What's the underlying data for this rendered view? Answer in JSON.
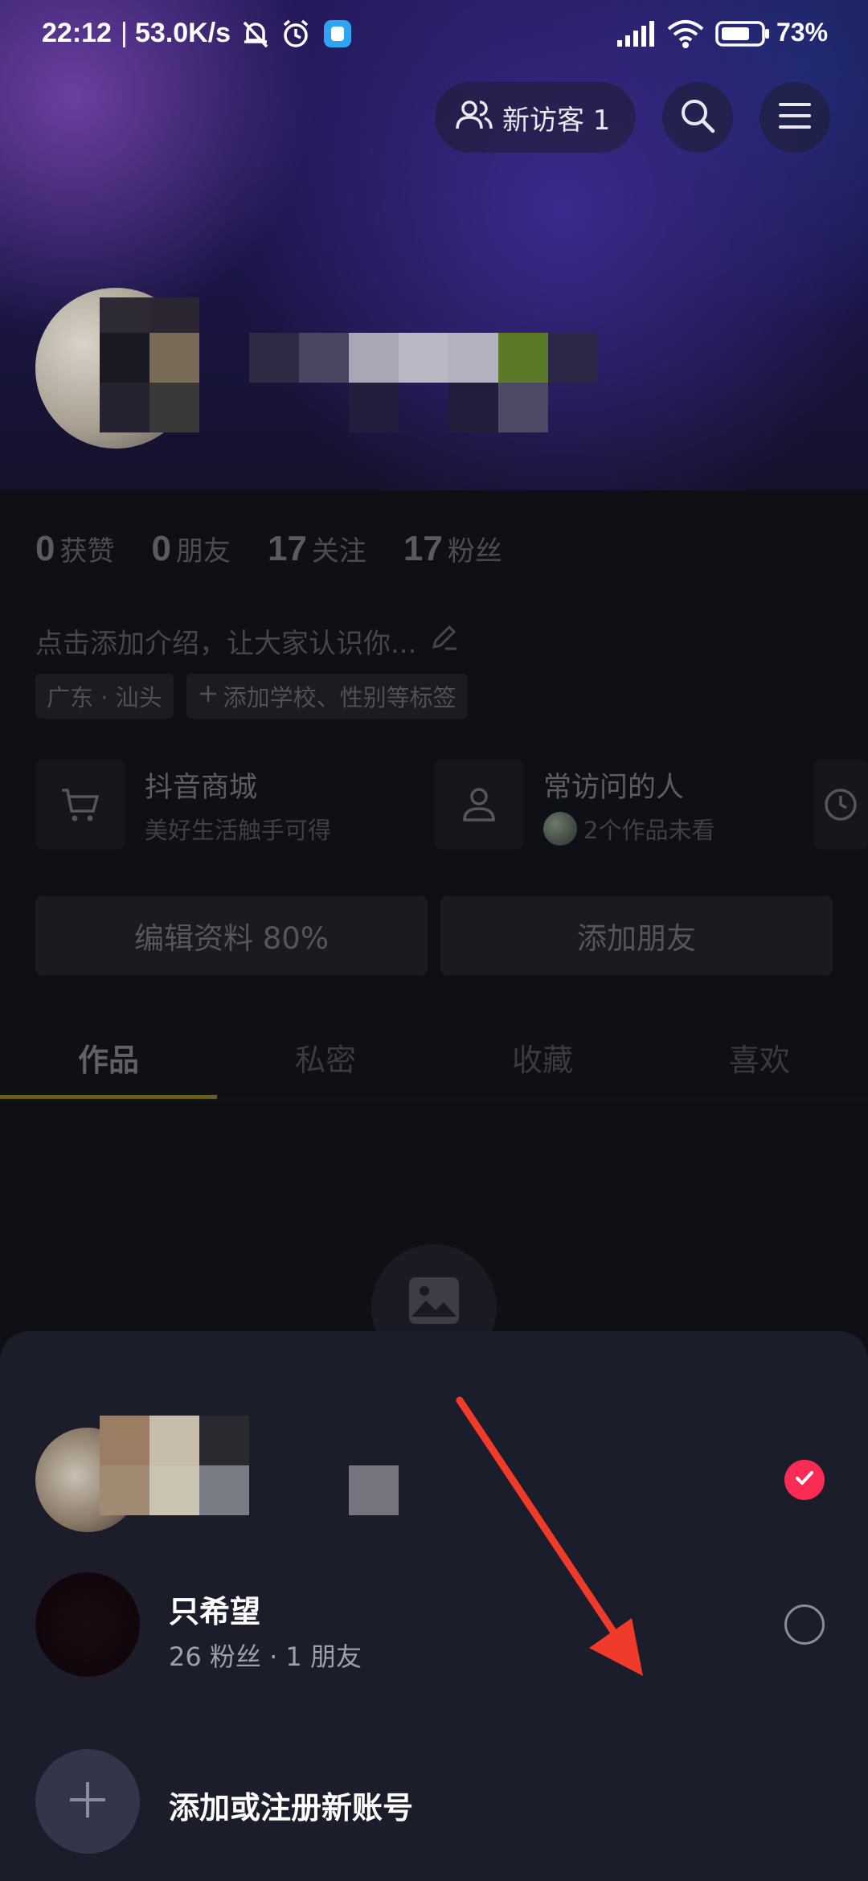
{
  "status_bar": {
    "time": "22:12",
    "separator": "|",
    "network_speed": "53.0K/s",
    "battery_percent": "73%",
    "icons": [
      "mute-bell-icon",
      "alarm-icon",
      "app-notification-icon",
      "signal-icon",
      "wifi-icon",
      "battery-icon"
    ]
  },
  "header": {
    "visitor_label": "新访客 1",
    "search_icon": "search-icon",
    "menu_icon": "menu-icon"
  },
  "profile": {
    "stats": [
      {
        "num": "0",
        "label": "获赞"
      },
      {
        "num": "0",
        "label": "朋友"
      },
      {
        "num": "17",
        "label": "关注"
      },
      {
        "num": "17",
        "label": "粉丝"
      }
    ],
    "bio_placeholder": "点击添加介绍，让大家认识你...",
    "tags": [
      "广东 · 汕头",
      "添加学校、性别等标签"
    ],
    "shortcuts": [
      {
        "title": "抖音商城",
        "subtitle": "美好生活触手可得"
      },
      {
        "title": "常访问的人",
        "subtitle": "2个作品未看"
      }
    ],
    "buttons": {
      "edit": "编辑资料 80%",
      "add_friend": "添加朋友"
    },
    "tabs": [
      "作品",
      "私密",
      "收藏",
      "喜欢"
    ]
  },
  "account_sheet": {
    "accounts": [
      {
        "name": "",
        "subtitle": "",
        "selected": true
      },
      {
        "name": "只希望",
        "subtitle": "26 粉丝  ·  1 朋友",
        "selected": false
      }
    ],
    "add_label": "添加或注册新账号"
  },
  "colors": {
    "accent_red": "#fe2c55",
    "annotation_arrow": "#f03a2a",
    "sheet_bg": "#1c1d2a"
  }
}
